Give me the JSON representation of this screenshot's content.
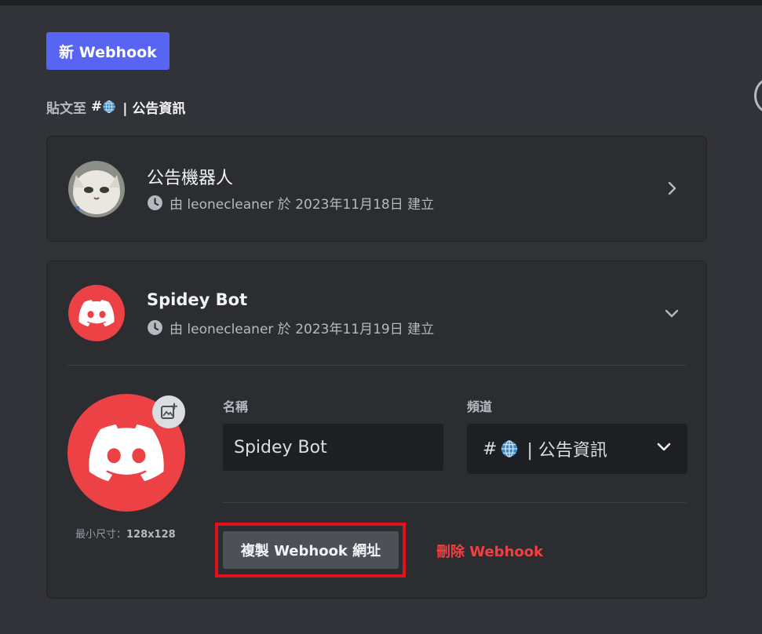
{
  "toolbar": {
    "new_webhook_label": "新 Webhook"
  },
  "post_to": {
    "prefix": "貼文至",
    "hash": "#",
    "channel_name": "| 公告資訊"
  },
  "webhooks": [
    {
      "name": "公告機器人",
      "meta": "由 leonecleaner 於 2023年11月18日 建立",
      "avatar_icon": "cat-avatar",
      "expanded": false
    },
    {
      "name": "Spidey Bot",
      "meta": "由 leonecleaner 於 2023年11月19日 建立",
      "avatar_icon": "discord-logo",
      "expanded": true,
      "editor": {
        "min_size_label": "最小尺寸：",
        "min_size_value": "128x128",
        "name_label": "名稱",
        "name_value": "Spidey Bot",
        "channel_label": "頻道",
        "channel_hash": "#",
        "channel_value": "| 公告資訊",
        "copy_url_label": "複製 Webhook 網址",
        "delete_label": "刪除 Webhook"
      }
    }
  ],
  "colors": {
    "background": "#313338",
    "card": "#2b2d31",
    "brand": "#5865f2",
    "avatar_red": "#ed4245",
    "danger_text": "#f23f42",
    "highlight_box": "#e1121b"
  }
}
